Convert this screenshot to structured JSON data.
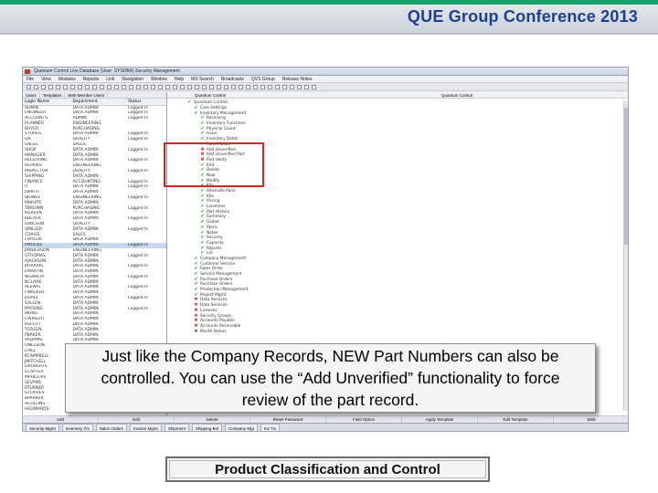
{
  "header": {
    "title": "QUE Group Conference 2013",
    "accent_color": "#16a36b",
    "title_color": "#1d3f8c"
  },
  "app": {
    "titlebar": "Quantum Control   Live Database (User: SYSDBA)   Security Management",
    "menu": [
      "File",
      "View",
      "Modules",
      "Reports",
      "Link",
      "Navigation",
      "Window",
      "Help",
      "MX Search",
      "Broadcasts",
      "QVS Group",
      "Release Notes"
    ],
    "left_tabs": [
      "Users",
      "Templates",
      "Web Member Users"
    ],
    "user_table": {
      "headers": [
        "Login Name",
        "Department",
        "Status"
      ],
      "rows": [
        [
          "ADMIN",
          "DATA ADMIN",
          "Logged In"
        ],
        [
          "ENGINEER",
          "DATA ADMIN",
          "Logged In"
        ],
        [
          "ACCOUNTS",
          "ADMIN",
          "Logged In"
        ],
        [
          "PLANNER",
          "ENGINEERING",
          ""
        ],
        [
          "BUYER",
          "PURCHASING",
          ""
        ],
        [
          "STORES",
          "DATA ADMIN",
          "Logged In"
        ],
        [
          "QA",
          "QUALITY",
          "Logged In"
        ],
        [
          "SALES",
          "SALES",
          ""
        ],
        [
          "SHOP",
          "DATA ADMIN",
          "Logged In"
        ],
        [
          "MANAGER",
          "DATA ADMIN",
          ""
        ],
        [
          "RECEIVING",
          "DATA ADMIN",
          "Logged In"
        ],
        [
          "REPAIRS",
          "ENGINEERING",
          ""
        ],
        [
          "INSPECTOR",
          "QUALITY",
          "Logged In"
        ],
        [
          "SHIPPING",
          "DATA ADMIN",
          ""
        ],
        [
          "FINANCE",
          "ACCOUNTING",
          "Logged In"
        ],
        [
          "IT",
          "DATA ADMIN",
          "Logged In"
        ],
        [
          "JSMITH",
          "DATA ADMIN",
          ""
        ],
        [
          "BJONES",
          "ENGINEERING",
          "Logged In"
        ],
        [
          "MWHITE",
          "DATA ADMIN",
          ""
        ],
        [
          "TBROWN",
          "PURCHASING",
          "Logged In"
        ],
        [
          "KGREEN",
          "DATA ADMIN",
          ""
        ],
        [
          "RBLACK",
          "DATA ADMIN",
          "Logged In"
        ],
        [
          "DWILSON",
          "QUALITY",
          ""
        ],
        [
          "SMILLER",
          "DATA ADMIN",
          "Logged In"
        ],
        [
          "CDAVIS",
          "SALES",
          ""
        ],
        [
          "LTAYLOR",
          "DATA ADMIN",
          ""
        ],
        [
          "PMOORE",
          "DATA ADMIN",
          "Logged In"
        ],
        [
          "JANDERSON",
          "ENGINEERING",
          ""
        ],
        [
          "GTHOMAS",
          "DATA ADMIN",
          "Logged In"
        ],
        [
          "HJACKSON",
          "DATA ADMIN",
          ""
        ],
        [
          "RHARRIS",
          "DATA ADMIN",
          "Logged In"
        ],
        [
          "EMARTIN",
          "DATA ADMIN",
          ""
        ],
        [
          "WGARCIA",
          "DATA ADMIN",
          "Logged In"
        ],
        [
          "NCLARK",
          "DATA ADMIN",
          ""
        ],
        [
          "ALEWIS",
          "DATA ADMIN",
          "Logged In"
        ],
        [
          "FWALKER",
          "DATA ADMIN",
          ""
        ],
        [
          "DHALL",
          "DATA ADMIN",
          "Logged In"
        ],
        [
          "SALLEN",
          "DATA ADMIN",
          ""
        ],
        [
          "MYOUNG",
          "DATA ADMIN",
          "Logged In"
        ],
        [
          "BKING",
          "DATA ADMIN",
          ""
        ],
        [
          "CWRIGHT",
          "DATA ADMIN",
          ""
        ],
        [
          "RSCOTT",
          "DATA ADMIN",
          ""
        ],
        [
          "TGREEN",
          "DATA ADMIN",
          ""
        ],
        [
          "PBAKER",
          "DATA ADMIN",
          ""
        ],
        [
          "VADAMS",
          "DATA ADMIN",
          ""
        ],
        [
          "ONELSON",
          "DATA ADMIN",
          ""
        ],
        [
          "LHILL",
          "DATA ADMIN",
          ""
        ],
        [
          "KCAMPBELL",
          "DATA ADMIN",
          ""
        ],
        [
          "JMITCHELL",
          "DATA ADMIN",
          ""
        ],
        [
          "DROBERTS",
          "DATA ADMIN",
          ""
        ],
        [
          "ECARTER",
          "DATA ADMIN",
          ""
        ],
        [
          "MPHILLIPS",
          "DATA ADMIN",
          ""
        ],
        [
          "SEVANS",
          "DATA ADMIN",
          ""
        ],
        [
          "RTURNER",
          "DATA ADMIN",
          ""
        ],
        [
          "GTORRES",
          "DATA ADMIN",
          ""
        ],
        [
          "BPARKER",
          "DATA ADMIN",
          ""
        ],
        [
          "ACOLLINS",
          "DATA ADMIN",
          ""
        ],
        [
          "HEDWARDS",
          "DATA ADMIN",
          ""
        ]
      ],
      "selected_index": 26
    },
    "tree_header": "Quantum Control",
    "tree_root": "Quantum Control",
    "tree": [
      {
        "label": "Quantum Control",
        "mark": "ok",
        "indent": 0
      },
      {
        "label": "Core Settings",
        "mark": "ok",
        "indent": 1
      },
      {
        "label": "Inventory Management",
        "mark": "ok",
        "indent": 1
      },
      {
        "label": "Receiving",
        "mark": "ok",
        "indent": 2
      },
      {
        "label": "Inventory Functions",
        "mark": "ok",
        "indent": 2
      },
      {
        "label": "Physical Count",
        "mark": "ok",
        "indent": 2
      },
      {
        "label": "Issue",
        "mark": "ok",
        "indent": 2
      },
      {
        "label": "Inventory Detail",
        "mark": "ok",
        "indent": 2
      },
      {
        "label": "Parts Master",
        "mark": "ok",
        "indent": 2
      },
      {
        "label": "Add Unverified",
        "mark": "no",
        "indent": 2
      },
      {
        "label": "Add Unverified Part",
        "mark": "no",
        "indent": 2
      },
      {
        "label": "Part Verify",
        "mark": "no",
        "indent": 2
      },
      {
        "label": "Edit",
        "mark": "ok",
        "indent": 2
      },
      {
        "label": "Delete",
        "mark": "ok",
        "indent": 2
      },
      {
        "label": "New",
        "mark": "ok",
        "indent": 2
      },
      {
        "label": "Modify",
        "mark": "ok",
        "indent": 2
      },
      {
        "label": "Kits",
        "mark": "ok",
        "indent": 2
      },
      {
        "label": "Alternate Parts",
        "mark": "ok",
        "indent": 2
      },
      {
        "label": "Kits",
        "mark": "ok",
        "indent": 2
      },
      {
        "label": "Pricing",
        "mark": "ok",
        "indent": 2
      },
      {
        "label": "Locations",
        "mark": "ok",
        "indent": 2
      },
      {
        "label": "Part History",
        "mark": "ok",
        "indent": 2
      },
      {
        "label": "Summary",
        "mark": "ok",
        "indent": 2
      },
      {
        "label": "Global",
        "mark": "ok",
        "indent": 2
      },
      {
        "label": "Stock",
        "mark": "ok",
        "indent": 2
      },
      {
        "label": "Notes",
        "mark": "ok",
        "indent": 2
      },
      {
        "label": "Security",
        "mark": "ok",
        "indent": 2
      },
      {
        "label": "Capacity",
        "mark": "ok",
        "indent": 2
      },
      {
        "label": "Reports",
        "mark": "ok",
        "indent": 2
      },
      {
        "label": "Lot",
        "mark": "ok",
        "indent": 2
      },
      {
        "label": "Company Management",
        "mark": "ok",
        "indent": 1
      },
      {
        "label": "Customer Service",
        "mark": "ok",
        "indent": 1
      },
      {
        "label": "Sales Order",
        "mark": "ok",
        "indent": 1
      },
      {
        "label": "Service Management",
        "mark": "ok",
        "indent": 1
      },
      {
        "label": "Purchase Orders",
        "mark": "ok",
        "indent": 1
      },
      {
        "label": "Purchase Orders",
        "mark": "ok",
        "indent": 1
      },
      {
        "label": "Production Management",
        "mark": "ok",
        "indent": 1
      },
      {
        "label": "Project Mgmt",
        "mark": "ok",
        "indent": 1
      },
      {
        "label": "Data Services",
        "mark": "no",
        "indent": 1
      },
      {
        "label": "Data Services",
        "mark": "no",
        "indent": 1
      },
      {
        "label": "Licenses",
        "mark": "no",
        "indent": 1
      },
      {
        "label": "Security Groups",
        "mark": "no",
        "indent": 1
      },
      {
        "label": "Accounts Payable",
        "mark": "no",
        "indent": 1
      },
      {
        "label": "Accounts Receivable",
        "mark": "no",
        "indent": 1
      },
      {
        "label": "Month Status",
        "mark": "no",
        "indent": 1
      }
    ],
    "bottom_buttons": [
      "Add",
      "Edit",
      "Delete",
      "Reset Password",
      "Field Option",
      "Apply Template",
      "Edit Template",
      "Web"
    ],
    "taskbar": [
      "Security Mgmt",
      "Inventory Trx",
      "Sales Orders",
      "Invoice Mgmt",
      "Shipment",
      "Shipping Bsl",
      "Company Mgt",
      "Inv Trx"
    ]
  },
  "callout": {
    "text": "Just like the Company Records, NEW Part Numbers can also be controlled. You can use the “Add Unverified” functionality to force review of the part record."
  },
  "footer": {
    "label": "Product Classification and Control"
  },
  "colors": {
    "highlight": "#e0211f",
    "check": "#1a9a2e",
    "cross": "#d0312d"
  }
}
